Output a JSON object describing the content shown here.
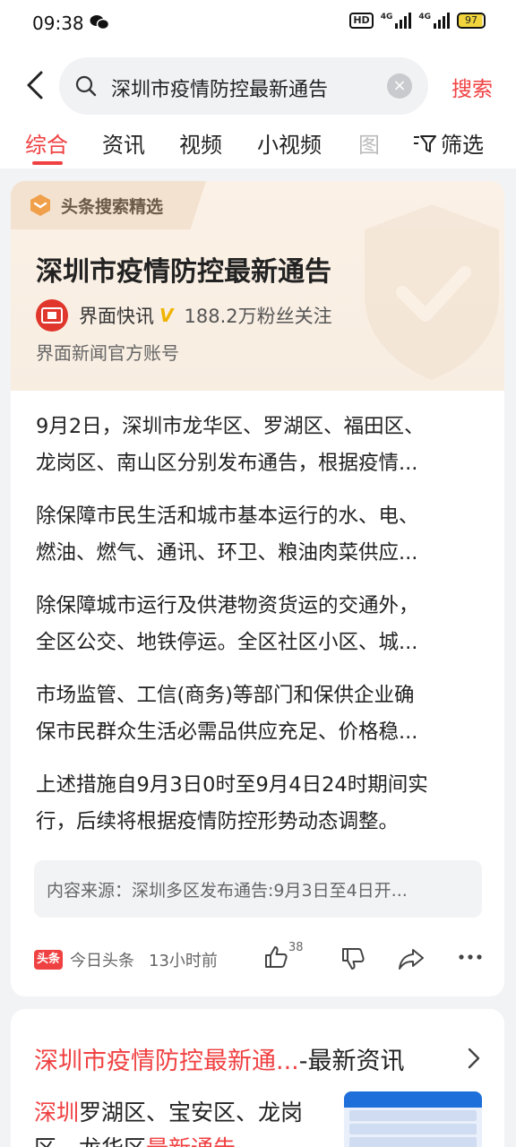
{
  "status_bar": {
    "time": "09:38",
    "hd_label": "HD",
    "net1": "4G",
    "net2": "4G",
    "battery": "97"
  },
  "search": {
    "query": "深圳市疫情防控最新通告",
    "button": "搜索"
  },
  "tabs": [
    "综合",
    "资讯",
    "视频",
    "小视频",
    "图"
  ],
  "filter_label": "筛选",
  "card": {
    "badge": "头条搜索精选",
    "title": "深圳市疫情防控最新通告",
    "author": "界面快讯",
    "fans": "188.2万粉丝关注",
    "author_desc": "界面新闻官方账号",
    "paragraphs": [
      [
        "9月2日，深圳市龙华区、罗湖区、福田区、",
        "龙岗区、南山区分别发布通告，根据疫情..."
      ],
      [
        "除保障市民生活和城市基本运行的水、电、",
        "燃油、燃气、通讯、环卫、粮油肉菜供应..."
      ],
      [
        "除保障城市运行及供港物资货运的交通外，",
        "全区公交、地铁停运。全区社区小区、城..."
      ],
      [
        "市场监管、工信(商务)等部门和保供企业确",
        "保市民群众生活必需品供应充足、价格稳..."
      ],
      [
        "上述措施自9月3日0时至9月4日24时期间实",
        "行，后续将根据疫情防控形势动态调整。"
      ]
    ],
    "source": "内容来源：深圳多区发布通告:9月3日至4日开...",
    "footer": {
      "brand": "头条",
      "app": "今日头条",
      "ago": "13小时前",
      "likes": "38"
    }
  },
  "card2": {
    "title_highlight": "深圳市疫情防控最新通...",
    "title_rest": "-最新资讯",
    "snippet_line1_hl": "深圳",
    "snippet_line1": "罗湖区、宝安区、龙岗",
    "snippet_line2": "区、龙华区",
    "snippet_line2_hl": "最新通告"
  },
  "colors": {
    "accent": "#f04142",
    "badge_bg": "#f3e2cf",
    "card_head_bg": "#fbf1e6"
  }
}
